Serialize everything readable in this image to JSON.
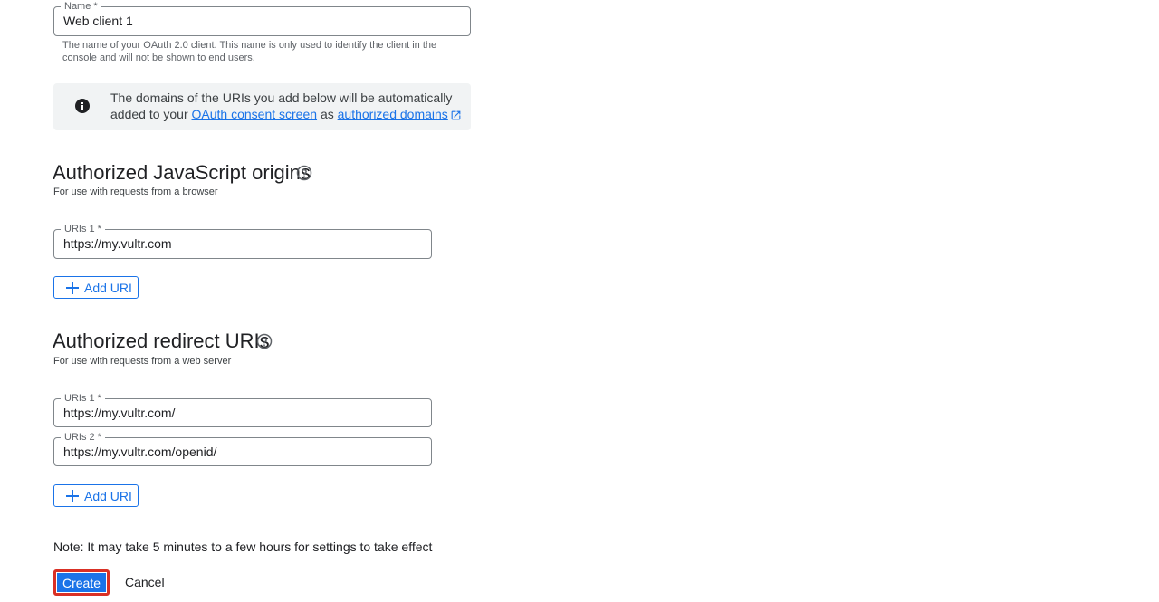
{
  "name_field": {
    "label": "Name *",
    "value": "Web client 1",
    "helper": "The name of your OAuth 2.0 client. This name is only used to identify the client in the console and will not be shown to end users."
  },
  "info": {
    "text_before": "The domains of the URIs you add below will be automatically added to your",
    "link1": "OAuth consent screen",
    "text_middle": "as",
    "link2": "authorized domains"
  },
  "js_origins": {
    "title": "Authorized JavaScript origins",
    "subtitle": "For use with requests from a browser",
    "uris": [
      {
        "label": "URIs 1 *",
        "value": "https://my.vultr.com"
      }
    ],
    "add_label": "Add URI"
  },
  "redirect_uris": {
    "title": "Authorized redirect URIs",
    "subtitle": "For use with requests from a web server",
    "uris": [
      {
        "label": "URIs 1 *",
        "value": "https://my.vultr.com/"
      },
      {
        "label": "URIs 2 *",
        "value": "https://my.vultr.com/openid/"
      }
    ],
    "add_label": "Add URI"
  },
  "note": "Note: It may take 5 minutes to a few hours for settings to take effect",
  "actions": {
    "create": "Create",
    "cancel": "Cancel"
  },
  "colors": {
    "primary": "#1a73e8",
    "focus_outline": "#d93025",
    "info_bg": "#f1f3f4"
  }
}
